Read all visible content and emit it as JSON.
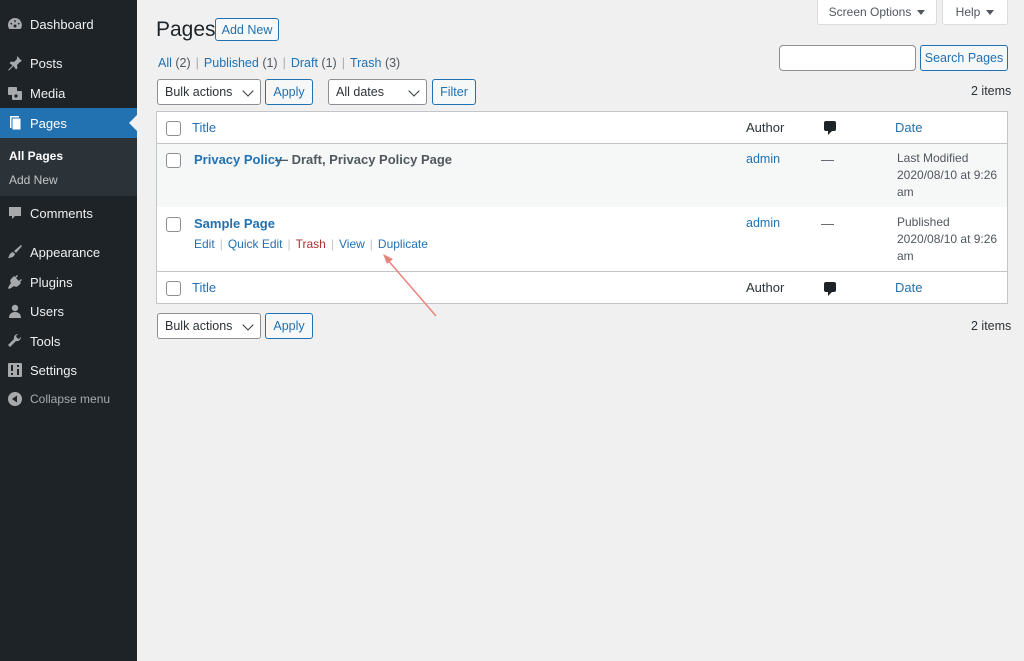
{
  "sidebar": {
    "items": [
      {
        "label": "Dashboard",
        "icon": "dashboard-icon"
      },
      {
        "label": "Posts",
        "icon": "pushpin-icon"
      },
      {
        "label": "Media",
        "icon": "media-icon"
      },
      {
        "label": "Pages",
        "icon": "page-icon"
      },
      {
        "label": "Comments",
        "icon": "comment-icon"
      },
      {
        "label": "Appearance",
        "icon": "brush-icon"
      },
      {
        "label": "Plugins",
        "icon": "plugin-icon"
      },
      {
        "label": "Users",
        "icon": "user-icon"
      },
      {
        "label": "Tools",
        "icon": "wrench-icon"
      },
      {
        "label": "Settings",
        "icon": "settings-icon"
      }
    ],
    "submenu": [
      {
        "label": "All Pages"
      },
      {
        "label": "Add New"
      }
    ],
    "collapse_label": "Collapse menu"
  },
  "screen_meta": {
    "screen_options": "Screen Options",
    "help": "Help"
  },
  "header": {
    "title": "Pages",
    "add_new": "Add New"
  },
  "views": [
    {
      "label": "All",
      "count": "(2)"
    },
    {
      "label": "Published",
      "count": "(1)"
    },
    {
      "label": "Draft",
      "count": "(1)"
    },
    {
      "label": "Trash",
      "count": "(3)"
    }
  ],
  "search": {
    "button": "Search Pages",
    "value": ""
  },
  "tablenav_top": {
    "bulk_actions": "Bulk actions",
    "apply": "Apply",
    "dates": "All dates",
    "filter": "Filter",
    "items": "2 items"
  },
  "tablenav_bottom": {
    "bulk_actions": "Bulk actions",
    "apply": "Apply",
    "items": "2 items"
  },
  "table": {
    "columns": {
      "title": "Title",
      "author": "Author",
      "date": "Date"
    },
    "rows": [
      {
        "title": "Privacy Policy",
        "state": "— Draft, Privacy Policy Page",
        "author": "admin",
        "comments": "—",
        "date_status": "Last Modified",
        "date_value": "2020/08/10 at 9:26",
        "date_time_suffix": "am"
      },
      {
        "title": "Sample Page",
        "state": "",
        "author": "admin",
        "comments": "—",
        "date_status": "Published",
        "date_value": "2020/08/10 at 9:26",
        "date_time_suffix": "am",
        "actions": {
          "edit": "Edit",
          "quick_edit": "Quick Edit",
          "trash": "Trash",
          "view": "View",
          "duplicate": "Duplicate"
        }
      }
    ]
  },
  "colors": {
    "sidebar_bg": "#1d2327",
    "accent": "#2271b1",
    "trash": "#b32d2e",
    "annotation_arrow": "#e8837d"
  }
}
